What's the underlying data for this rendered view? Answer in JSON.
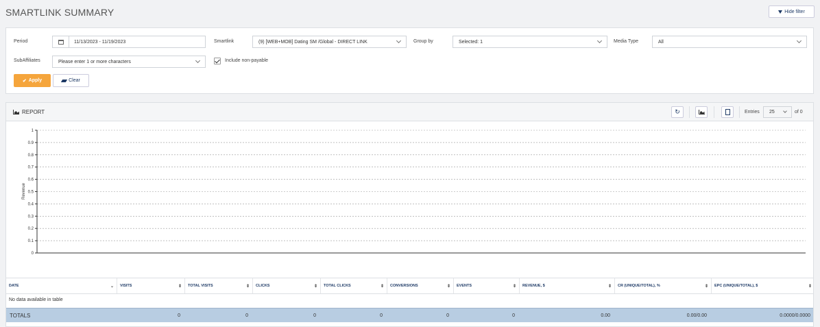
{
  "page": {
    "title": "SMARTLINK SUMMARY",
    "hide_filter_label": "Hide filter"
  },
  "filters": {
    "period_label": "Period",
    "period_value": "11/13/2023 - 11/19/2023",
    "smartlink_label": "Smartlink",
    "smartlink_value": "(9) [WEB+MOB] Dating SM /Global - DIRECT LINK",
    "group_by_label": "Group by",
    "group_by_value": "Selected: 1",
    "media_type_label": "Media Type",
    "media_type_value": "All",
    "subaffiliates_label": "SubAffiliates",
    "subaffiliates_placeholder": "Please enter 1 or more characters",
    "include_nonpayable_label": "Include non-payable",
    "include_nonpayable_checked": true,
    "apply_label": "Apply",
    "clear_label": "Clear"
  },
  "report": {
    "title": "REPORT",
    "entries_label": "Entries",
    "entries_value": "25",
    "of_label": "of 0"
  },
  "chart_data": {
    "type": "line",
    "ylabel": "Revenue",
    "ylim": [
      0,
      1
    ],
    "yticks": [
      "0",
      "0.1",
      "0.2",
      "0.3",
      "0.4",
      "0.5",
      "0.6",
      "0.7",
      "0.8",
      "0.9",
      "1"
    ],
    "grid": true,
    "series": []
  },
  "table": {
    "columns": [
      "DATE",
      "VISITS",
      "TOTAL VISITS",
      "CLICKS",
      "TOTAL CLICKS",
      "CONVERSIONS",
      "EVENTS",
      "REVENUE, $",
      "CR (UNIQUE/TOTAL), %",
      "EPC (UNIQUE/TOTAL), $"
    ],
    "empty_message": "No data available in table",
    "totals_label": "TOTALS",
    "totals": [
      "0",
      "0",
      "0",
      "0",
      "0",
      "0",
      "0.00",
      "0.00/0.00",
      "0.0000/0.0000"
    ]
  },
  "colors": {
    "accent": "#f5a53c",
    "link": "#1e3a66",
    "totals_bg": "#b8cde2"
  },
  "icons": [
    "filter-icon",
    "calendar-icon",
    "chevron-down-icon",
    "check-icon",
    "eraser-icon",
    "area-chart-icon",
    "refresh-icon",
    "export-icon"
  ]
}
